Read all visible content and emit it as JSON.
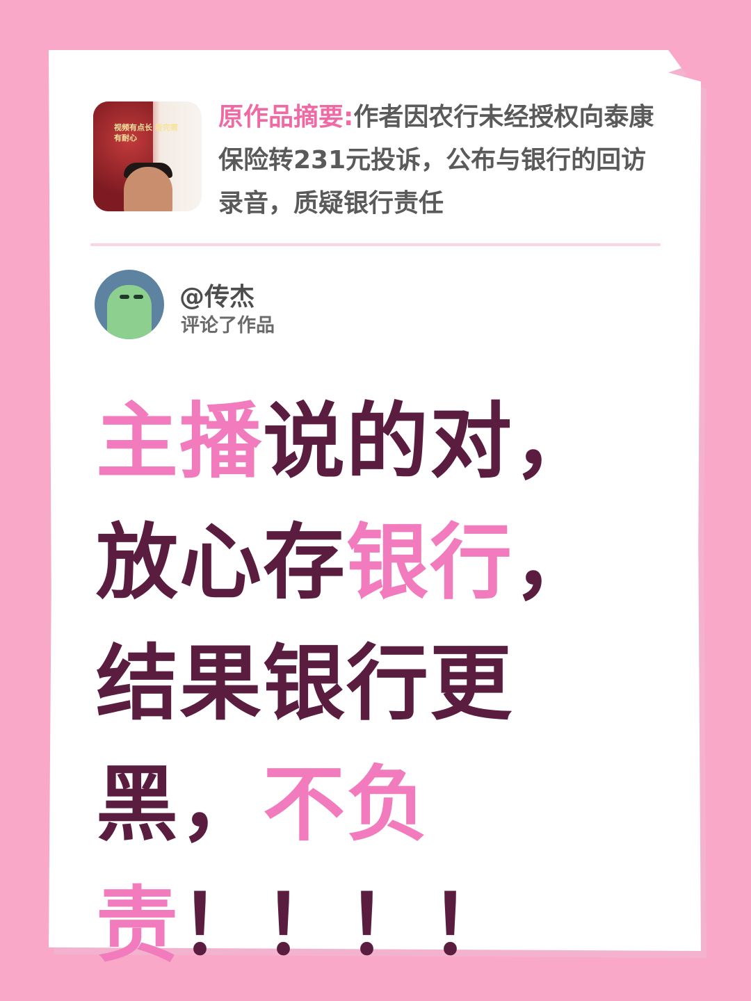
{
  "original": {
    "label": "原作品摘要:",
    "text": "作者因农行未经授权向泰康保险转231元投诉，公布与银行的回访录音，质疑银行责任",
    "thumbnail_caption": "视频有点长 看完需有耐心"
  },
  "comment": {
    "username": "@传杰",
    "action": "评论了作品",
    "segments": [
      {
        "text": "主播",
        "highlight": true
      },
      {
        "text": "说的对，放心存",
        "highlight": false
      },
      {
        "text": "银行",
        "highlight": true
      },
      {
        "text": "，结果银行更黑，",
        "highlight": false
      },
      {
        "text": "不负责",
        "highlight": true
      },
      {
        "text": "！！！！",
        "highlight": false
      }
    ]
  },
  "colors": {
    "background": "#f9a8c8",
    "highlight": "#f27bbd",
    "text_dark": "#5a1d40",
    "label_pink": "#ef6aa4"
  }
}
